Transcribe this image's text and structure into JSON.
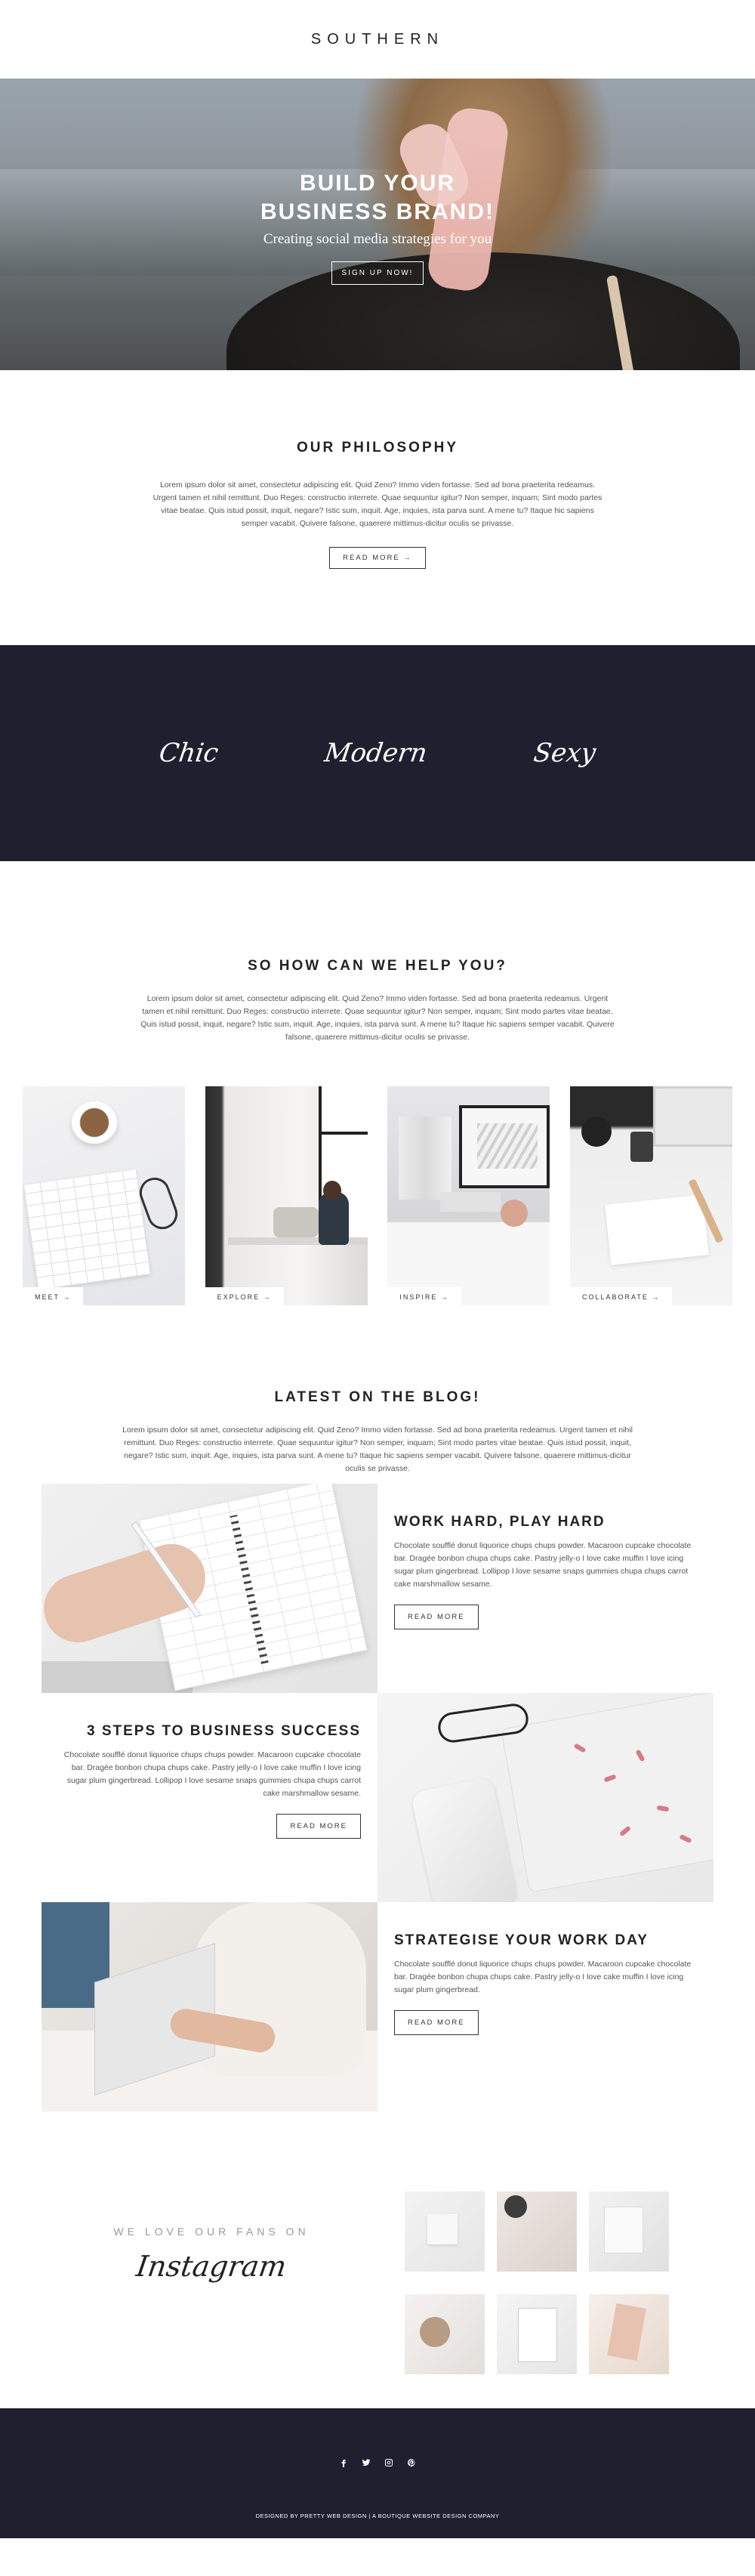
{
  "brand": {
    "logo": "SOUTHERN"
  },
  "hero": {
    "title": "BUILD YOUR BUSINESS BRAND!",
    "subtitle": "Creating social media strategies for you",
    "cta": "SIGN UP NOW!"
  },
  "philosophy": {
    "title": "OUR PHILOSOPHY",
    "body": "Lorem ipsum dolor sit amet, consectetur adipiscing elit. Quid Zeno? Immo viden fortasse. Sed ad bona praeterita redeamus. Urgent tamen et nihil remittunt. Duo Reges: constructio interrete. Quae sequuntur igitur? Non semper, inquam; Sint modo partes vitae beatae. Quis istud possit, inquit, negare? Istic sum, inquit. Age, inquies, ista parva sunt. A mene tu? Itaque hic sapiens semper vacabit. Quivere falsone, quaerere mittimus-dicitur oculis se privasse.",
    "button": "READ MORE →"
  },
  "band": {
    "words": [
      "Chic",
      "Modern",
      "Sexy"
    ]
  },
  "help": {
    "title": "SO HOW CAN WE HELP YOU?",
    "body": "Lorem ipsum dolor sit amet, consectetur adipiscing elit. Quid Zeno? Immo viden fortasse. Sed ad bona praeterita redeamus. Urgent tamen et nihil remittunt. Duo Reges: constructio interrete. Quae sequuntur igitur? Non semper, inquam; Sint modo partes vitae beatae. Quis istud possit, inquit, negare? Istic sum, inquit. Age, inquies, ista parva sunt. A mene tu? Itaque hic sapiens semper vacabit. Quivere falsone, quaerere mittimus-dicitur oculis se privasse.",
    "cards": [
      {
        "label": "MEET →"
      },
      {
        "label": "EXPLORE →"
      },
      {
        "label": "INSPIRE →"
      },
      {
        "label": "COLLABORATE →"
      }
    ]
  },
  "blog": {
    "title": "LATEST ON THE BLOG!",
    "intro": "Lorem ipsum dolor sit amet, consectetur adipiscing elit. Quid Zeno? Immo viden fortasse. Sed ad bona praeterita redeamus. Urgent tamen et nihil remittunt. Duo Reges: constructio interrete. Quae sequuntur igitur? Non semper, inquam; Sint modo partes vitae beatae. Quis istud possit, inquit, negare? Istic sum, inquit. Age, inquies, ista parva sunt. A mene tu? Itaque hic sapiens semper vacabit. Quivere falsone, quaerere mittimus-dicitur oculis se privasse.",
    "posts": [
      {
        "title": "WORK HARD, PLAY HARD",
        "excerpt": "Chocolate soufflé donut liquorice chups chups powder. Macaroon cupcake chocolate bar. Dragée bonbon chupa chups cake. Pastry jelly-o I love cake muffin I love icing sugar plum gingerbread. Lollipop I love sesame snaps gummies chupa chups carrot cake marshmallow sesame.",
        "button": "READ MORE"
      },
      {
        "title": "3 STEPS TO BUSINESS SUCCESS",
        "excerpt": "Chocolate soufflé donut liquorice chups chups powder. Macaroon cupcake chocolate bar. Dragée bonbon chupa chups cake. Pastry jelly-o I love cake muffin I love icing sugar plum gingerbread. Lollipop I love sesame snaps gummies chupa chups carrot cake marshmallow sesame.",
        "button": "READ MORE"
      },
      {
        "title": "STRATEGISE YOUR WORK DAY",
        "excerpt": "Chocolate soufflé donut liquorice chups chups powder. Macaroon cupcake chocolate bar. Dragée bonbon chupa chups cake. Pastry jelly-o I love cake muffin I love icing sugar plum gingerbread.",
        "button": "READ MORE"
      }
    ]
  },
  "instagram": {
    "kicker": "WE LOVE OUR FANS ON",
    "script": "Instagram",
    "thumbs": 6
  },
  "footer": {
    "icons": [
      "facebook-icon",
      "twitter-icon",
      "instagram-icon",
      "pinterest-icon"
    ],
    "credits": "DESIGNED BY PRETTY WEB DESIGN | A BOUTIQUE WEBSITE DESIGN COMPANY"
  },
  "colors": {
    "dark": "#1f1f2f",
    "text": "#2f2f2f",
    "muted": "#555555"
  }
}
